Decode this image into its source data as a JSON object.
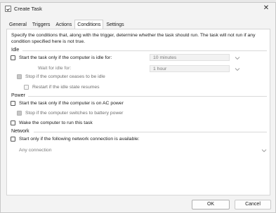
{
  "window": {
    "title": "Create Task",
    "close_glyph": "✕"
  },
  "tabs": [
    {
      "label": "General"
    },
    {
      "label": "Triggers"
    },
    {
      "label": "Actions"
    },
    {
      "label": "Conditions",
      "active": true
    },
    {
      "label": "Settings"
    }
  ],
  "description": "Specify the conditions that, along with the trigger, determine whether the task should run.  The task will not run  if any condition specified here is not true.",
  "idle": {
    "heading": "Idle",
    "start_only_idle": {
      "label": "Start the task only if the computer is idle for:",
      "checked": false
    },
    "idle_for_value": "10 minutes",
    "wait_label": "Wait for idle for:",
    "wait_value": "1 hour",
    "stop_if_not_idle": {
      "label": "Stop if the computer ceases to be idle",
      "checked": true,
      "disabled": true
    },
    "restart_if_idle": {
      "label": "Restart if the idle state resumes",
      "checked": false,
      "disabled": true
    }
  },
  "power": {
    "heading": "Power",
    "start_on_ac": {
      "label": "Start the task only if the computer is on AC power",
      "checked": false
    },
    "stop_on_battery": {
      "label": "Stop if the computer switches to battery power",
      "checked": true,
      "disabled": true
    },
    "wake": {
      "label": "Wake the computer to run this task",
      "checked": false
    }
  },
  "network": {
    "heading": "Network",
    "start_only_network": {
      "label": "Start only if the following network connection is available:",
      "checked": false
    },
    "connection_value": "Any connection"
  },
  "buttons": {
    "ok": "OK",
    "cancel": "Cancel"
  },
  "colors": {
    "panel_bg": "#ffffff",
    "window_bg": "#f3f3f3",
    "disabled_text": "#7a7a7a"
  },
  "icons": {
    "app": "task-check-icon",
    "chevron": "chevron-down-icon"
  }
}
